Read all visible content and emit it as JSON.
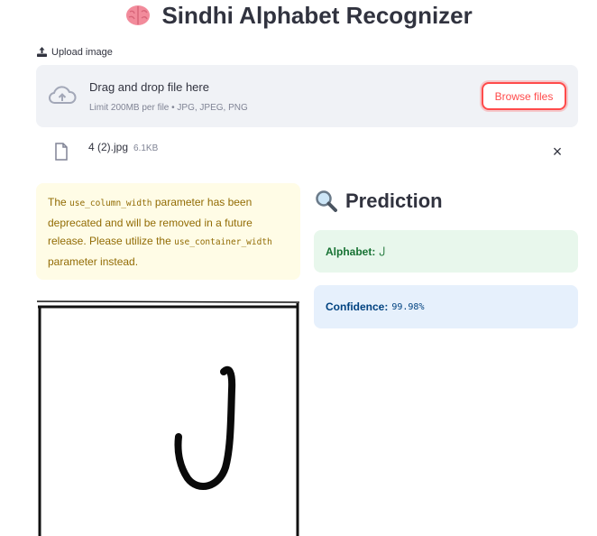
{
  "app": {
    "title": "Sindhi Alphabet Recognizer",
    "title_icon": "brain-icon"
  },
  "uploader": {
    "label": "Upload image",
    "drop_text": "Drag and drop file here",
    "limit_text": "Limit 200MB per file • JPG, JPEG, PNG",
    "browse_label": "Browse files"
  },
  "file": {
    "name": "4 (2).jpg",
    "size": "6.1KB"
  },
  "warning": {
    "part1": "The ",
    "code1": "use_column_width",
    "part2": " parameter has been deprecated and will be removed in a future release. Please utilize the ",
    "code2": "use_container_width",
    "part3": " parameter instead."
  },
  "prediction": {
    "heading": "Prediction",
    "alphabet_label": "Alphabet:",
    "alphabet_value": "ل",
    "confidence_label": "Confidence:",
    "confidence_value": "99.98%"
  },
  "colors": {
    "accent": "#ff4b4b",
    "success_bg": "#e8f7ec",
    "info_bg": "#e6f0fc",
    "warning_bg": "#fffce6"
  }
}
